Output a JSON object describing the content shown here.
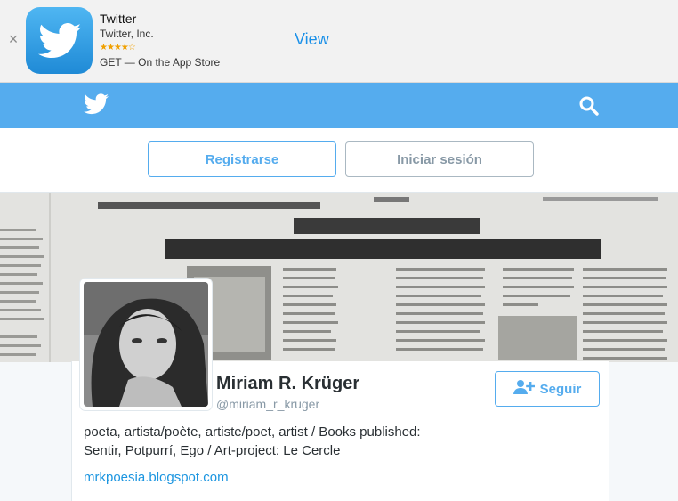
{
  "banner": {
    "close_glyph": "×",
    "app_name": "Twitter",
    "company": "Twitter, Inc.",
    "stars": "★★★★☆",
    "rating": 4,
    "get_text": "GET — On the App Store",
    "view_label": "View"
  },
  "nav": {
    "logo_icon": "twitter-bird-icon",
    "search_icon": "search-icon",
    "brand_color": "#55acee"
  },
  "auth": {
    "signup_label": "Registrarse",
    "login_label": "Iniciar sesión"
  },
  "header_image": {
    "description_icon": "newspaper-header-photo"
  },
  "profile": {
    "name": "Miriam R. Krüger",
    "handle": "@miriam_r_kruger",
    "follow_label": "Seguir",
    "bio_line1": "poeta, artista/poète, artiste/poet, artist / Books published:",
    "bio_line2": "Sentir, Potpurrí, Ego / Art-project: Le Cercle",
    "url": "mrkpoesia.blogspot.com"
  }
}
